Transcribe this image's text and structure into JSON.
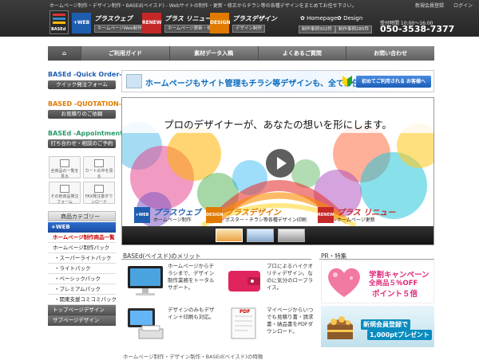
{
  "header": {
    "top_line": "ホームページ制作・デザイン制作・BASEd(ベイスド) - Webサイトの制作・更新・修正からチラシ等の各種デザインをまとめてお任せ下さい。",
    "top_links": [
      "新規会員登録",
      "ログイン"
    ],
    "logo_text": "BASEd",
    "services": [
      {
        "icon": "+WEB",
        "name": "プラスウェブ",
        "sub": "ホームページWeb制作",
        "color": "#1f5db0"
      },
      {
        "icon": "RENEW",
        "name": "プラス リニュー",
        "sub": "ホームページ更新・修正",
        "color": "#c62828"
      },
      {
        "icon": "DESIGN",
        "name": "プラスデザイン",
        "sub": "デザイン制作",
        "color": "#e07b00"
      }
    ],
    "homepage_label": "Homepage",
    "design_label": "Design",
    "homepage_count": "制作事例302件",
    "design_count": "制作事例285件",
    "phone_hours": "受付時間 10:00～16:00",
    "phone": "050-3538-7377"
  },
  "nav": {
    "items": [
      "ご利用ガイド",
      "素材データ入稿",
      "よくあるご質問",
      "お問い合わせ"
    ]
  },
  "sidebar": {
    "quick_logo": "BASEd -Quick Order-",
    "quick_btn": "クイック発注フォーム",
    "quote_logo": "BASED -QUOTATION-",
    "quote_btn": "お見積りのご依頼",
    "appt_logo": "BASEd -Appointment-",
    "appt_btn": "打ち合わせ・相談のご予約",
    "tiles": [
      "全商品の一覧を見る",
      "カートの中を見る",
      "その他商品発注フォーム",
      "FAX発注書ダウンロード"
    ],
    "category_title": "商品カテゴリー",
    "category_web": "+WEB",
    "category_items": [
      {
        "label": "ホームページ制作商品一覧",
        "style": "red"
      },
      {
        "label": "ホームページ制作パック",
        "style": "pack"
      },
      {
        "label": "・スーパーライトパック",
        "style": "sub"
      },
      {
        "label": "・ライトパック",
        "style": "sub"
      },
      {
        "label": "・ベーシックパック",
        "style": "sub"
      },
      {
        "label": "・プレミアムパック",
        "style": "sub"
      },
      {
        "label": "・関東支援コミコミパック",
        "style": "sub"
      },
      {
        "label": "トップページデザイン",
        "style": "dark"
      },
      {
        "label": "サブページデザイン",
        "style": "dark"
      }
    ]
  },
  "banner": {
    "text": "ホームページもサイト管理もチラシ等デザインも、全てお任せ下さい！",
    "button": "初めてご利用される お客様へ"
  },
  "slider": {
    "headline": "プロのデザイナーが、あなたの想いを形にします。",
    "labels": [
      {
        "key": "+WEB",
        "name": "プラスウェブ",
        "sub": "ホームページ制作",
        "color": "#1f5db0"
      },
      {
        "key": "DESIGN",
        "name": "プラスデザイン",
        "sub": "ポスター・チラシ等各種デザイン印刷",
        "color": "#e07b00"
      },
      {
        "key": "RENEW",
        "name": "プラス リニュー",
        "sub": "ホームページ更新",
        "color": "#c62828"
      }
    ]
  },
  "merits": {
    "heading": "BASEd(ベイスド)のメリット",
    "items": [
      "ホームページからチラシまで、デザイン制作業務をトータルサポート。",
      "プロによるハイクオリティデザイン。なのに気分のロープライス。",
      "デザインのみもデザイン＋印刷も対応。",
      "マイページからいつでも見積り書・請求書・納品書をPDFダウンロード。"
    ],
    "pdf_label": "PDF"
  },
  "pr": {
    "heading": "PR・特集",
    "card1_line1": "学割キャンペーン",
    "card1_line2": "全商品５％OFF",
    "card1_line3": "ポイント５倍",
    "card2_line1": "新規会員登録で",
    "card2_line2": "1,000ptプレゼント"
  },
  "footer_line": "ホームページ制作・デザイン制作・BASEd(ベイスド)の特徴"
}
